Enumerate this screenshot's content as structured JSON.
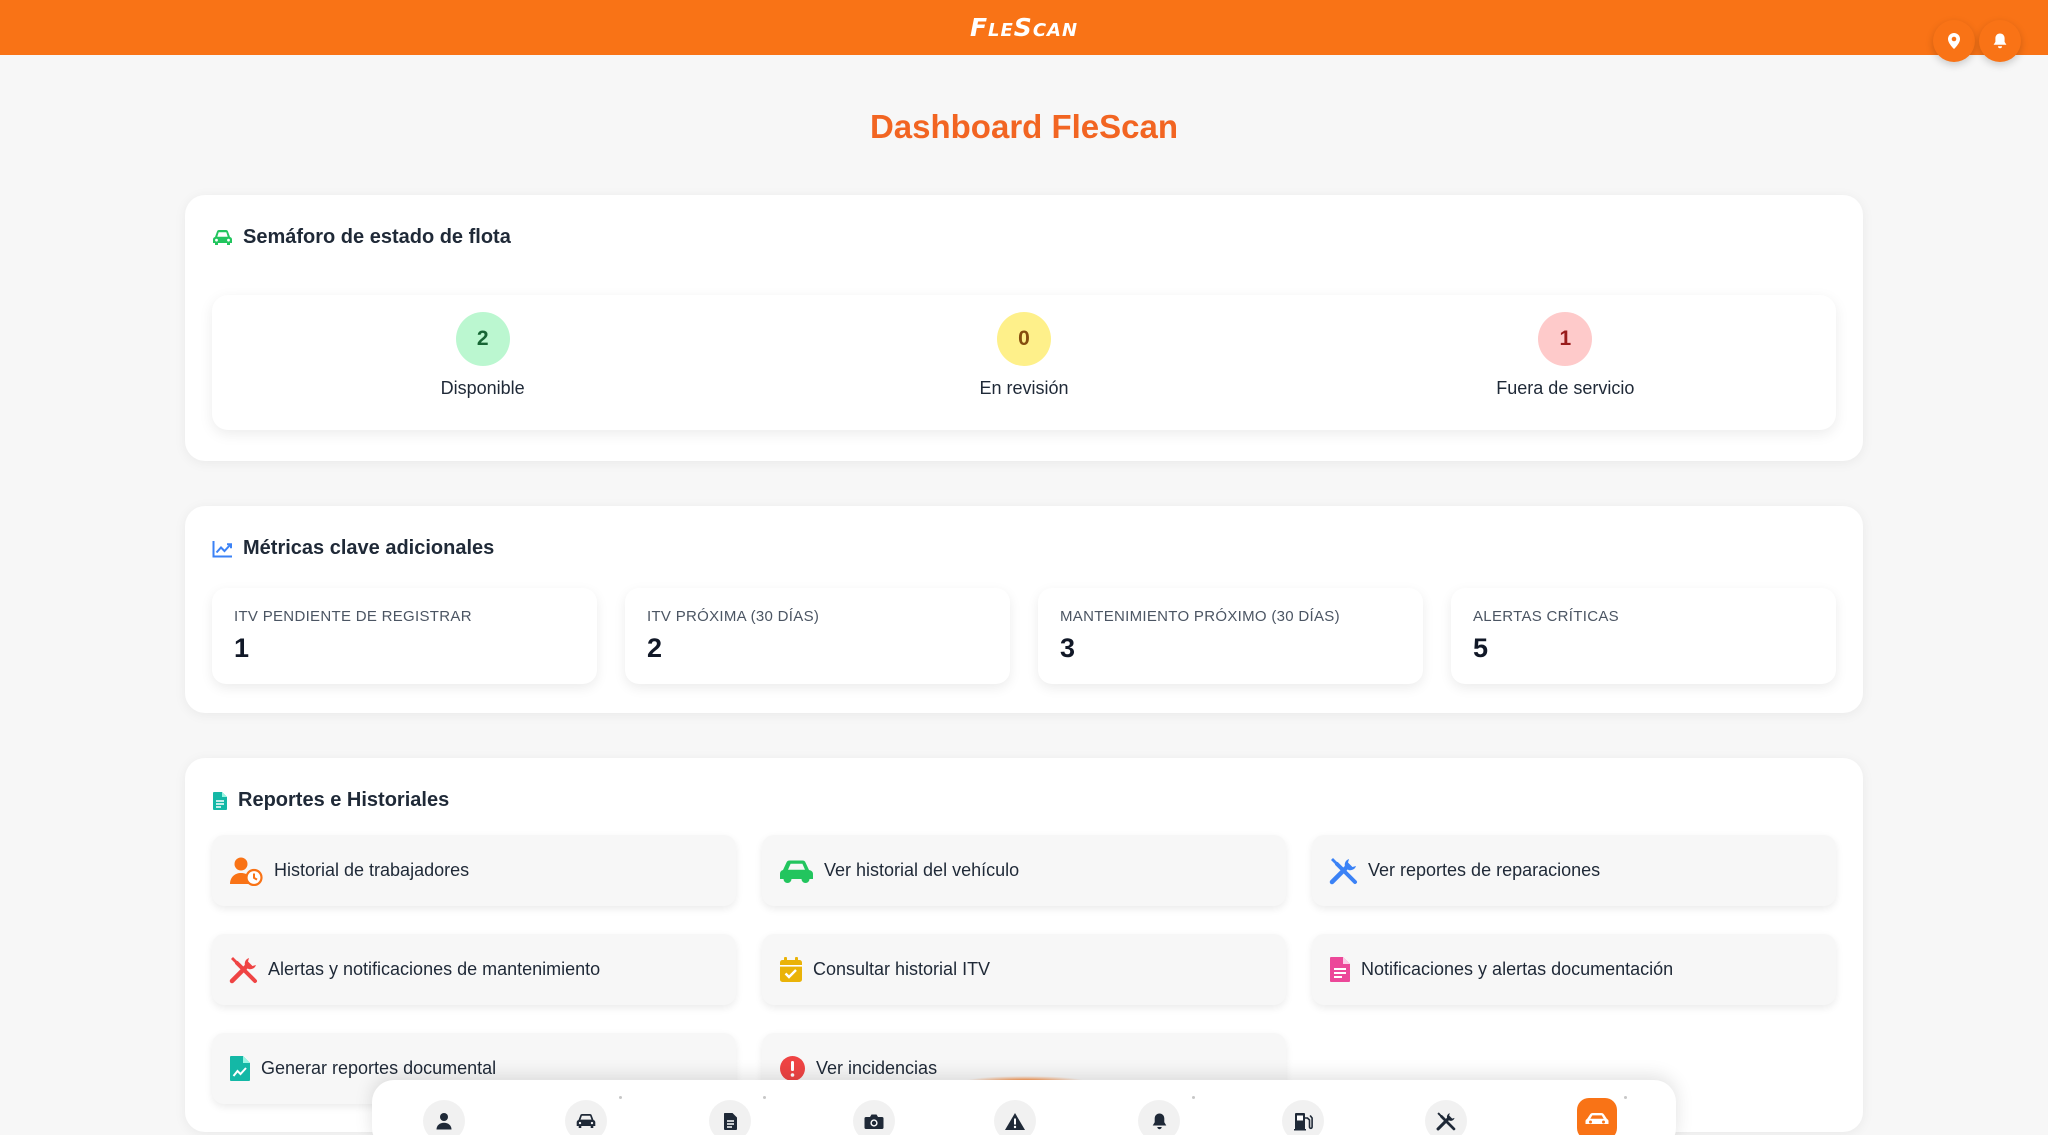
{
  "header": {
    "logo": "FleScan",
    "icons": [
      "location-pin-icon",
      "bell-icon"
    ]
  },
  "page_title": "Dashboard FleScan",
  "fleet_status": {
    "title": "Semáforo de estado de flota",
    "icon": "car-icon",
    "items": [
      {
        "count": "2",
        "label": "Disponible",
        "color": "#bbf7d0",
        "text_color": "#166534"
      },
      {
        "count": "0",
        "label": "En revisión",
        "color": "#fef08a",
        "text_color": "#854d0e"
      },
      {
        "count": "1",
        "label": "Fuera de servicio",
        "color": "#fecaca",
        "text_color": "#991b1b"
      }
    ]
  },
  "metrics": {
    "title": "Métricas clave adicionales",
    "icon": "chart-line-icon",
    "items": [
      {
        "label": "ITV PENDIENTE DE REGISTRAR",
        "value": "1"
      },
      {
        "label": "ITV PRÓXIMA (30 DÍAS)",
        "value": "2"
      },
      {
        "label": "MANTENIMIENTO PRÓXIMO (30 DÍAS)",
        "value": "3"
      },
      {
        "label": "ALERTAS CRÍTICAS",
        "value": "5"
      }
    ]
  },
  "reports": {
    "title": "Reportes e Historiales",
    "icon": "document-icon",
    "items": [
      {
        "label": "Historial de trabajadores",
        "icon": "user-clock-icon",
        "color": "#f97316"
      },
      {
        "label": "Ver historial del vehículo",
        "icon": "car-icon",
        "color": "#22c55e"
      },
      {
        "label": "Ver reportes de reparaciones",
        "icon": "tools-icon",
        "color": "#3b82f6"
      },
      {
        "label": "Alertas y notificaciones de mantenimiento",
        "icon": "tools-icon",
        "color": "#ef4444"
      },
      {
        "label": "Consultar historial ITV",
        "icon": "calendar-check-icon",
        "color": "#eab308"
      },
      {
        "label": "Notificaciones y alertas documentación",
        "icon": "document-icon",
        "color": "#ec4899"
      },
      {
        "label": "Generar reportes documental",
        "icon": "file-chart-icon",
        "color": "#14b8a6"
      },
      {
        "label": "Ver incidencias",
        "icon": "alert-circle-icon",
        "color": "#ef4444"
      }
    ]
  },
  "bottom_nav": {
    "items": [
      "user-icon",
      "car-icon",
      "document-icon",
      "camera-icon",
      "warning-icon",
      "bell-icon",
      "fuel-icon",
      "tools-icon",
      "car-front-icon"
    ],
    "active": "car-front-icon"
  },
  "colors": {
    "brand": "#f97316",
    "title": "#f26522"
  }
}
